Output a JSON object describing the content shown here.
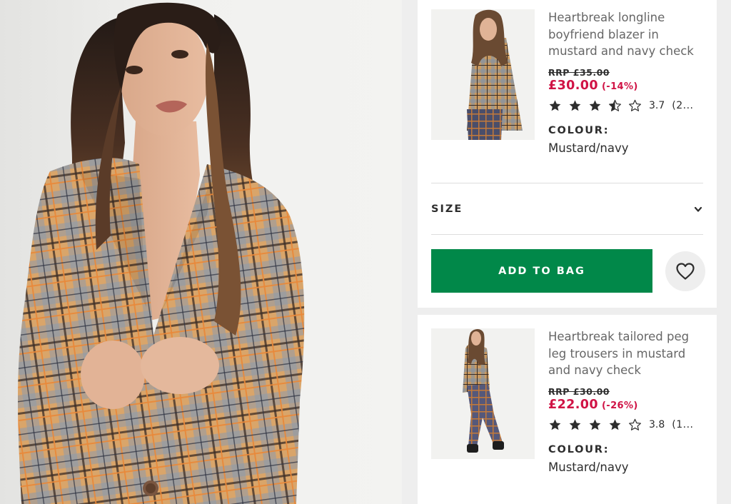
{
  "products": [
    {
      "title": "Heartbreak longline boyfriend blazer in mustard and navy check",
      "title_lines": [
        "Heartbreak longline",
        "boyfriend blazer in",
        "mustard and navy check"
      ],
      "rrp": "RRP £35.00",
      "price": "£30.00",
      "discount": "(-14%)",
      "rating_stars": 3.5,
      "rating": "3.7",
      "review_count": "(2...",
      "colour_label": "COLOUR:",
      "colour": "Mustard/navy"
    },
    {
      "title": "Heartbreak tailored peg leg trousers in mustard and navy check",
      "title_lines": [
        "Heartbreak tailored peg",
        "leg trousers in mustard",
        "and navy check"
      ],
      "rrp": "RRP £30.00",
      "price": "£22.00",
      "discount": "(-26%)",
      "rating_stars": 4,
      "rating": "3.8",
      "review_count": "(1...",
      "colour_label": "COLOUR:",
      "colour": "Mustard/navy"
    }
  ],
  "size": {
    "label": "SIZE"
  },
  "add_to_bag": {
    "label": "ADD TO BAG"
  },
  "icons": {
    "size_toggle": "chevron-down-icon",
    "wishlist": "heart-icon",
    "star_full": "star-filled-icon",
    "star_half": "star-half-icon",
    "star_empty": "star-outline-icon"
  },
  "colors": {
    "price": "#d01345",
    "add_to_bag": "#018849",
    "text": "#2d2d2d",
    "muted_text": "#666666",
    "panel_background": "#eeeeee"
  }
}
